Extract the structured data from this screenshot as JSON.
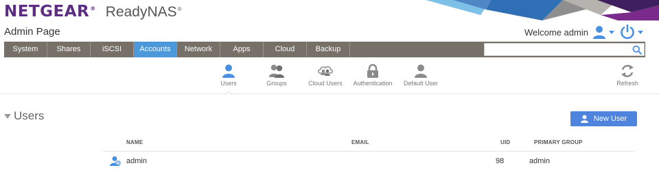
{
  "header": {
    "logo_text": "NETGEAR",
    "logo_mark": "®",
    "product": "ReadyNAS",
    "product_mark": "®",
    "page_title": "Admin Page",
    "welcome": "Welcome admin"
  },
  "colors": {
    "brand_purple": "#5c2d82",
    "nav_bg": "#777068",
    "nav_active": "#4b98db",
    "primary_button": "#4e84de",
    "icon_blue": "#4a90e2"
  },
  "nav": {
    "tabs": [
      {
        "label": "System",
        "active": false
      },
      {
        "label": "Shares",
        "active": false
      },
      {
        "label": "iSCSI",
        "active": false
      },
      {
        "label": "Accounts",
        "active": true
      },
      {
        "label": "Network",
        "active": false
      },
      {
        "label": "Apps",
        "active": false
      },
      {
        "label": "Cloud",
        "active": false
      },
      {
        "label": "Backup",
        "active": false
      }
    ],
    "search_value": "",
    "search_icon": "magnifier-icon"
  },
  "subnav": {
    "items": [
      {
        "label": "Users",
        "icon": "user-icon",
        "active": true
      },
      {
        "label": "Groups",
        "icon": "group-icon",
        "active": false
      },
      {
        "label": "Cloud Users",
        "icon": "cloud-users-icon",
        "active": false
      },
      {
        "label": "Authentication",
        "icon": "lock-icon",
        "active": false
      },
      {
        "label": "Default User",
        "icon": "default-user-icon",
        "active": false
      }
    ],
    "refresh_label": "Refresh"
  },
  "section": {
    "title": "Users",
    "new_button_label": "New User"
  },
  "table": {
    "columns": [
      "NAME",
      "EMAIL",
      "UID",
      "PRIMARY GROUP"
    ],
    "rows": [
      {
        "name": "admin",
        "email": "",
        "uid": "98",
        "primary_group": "admin"
      }
    ]
  }
}
